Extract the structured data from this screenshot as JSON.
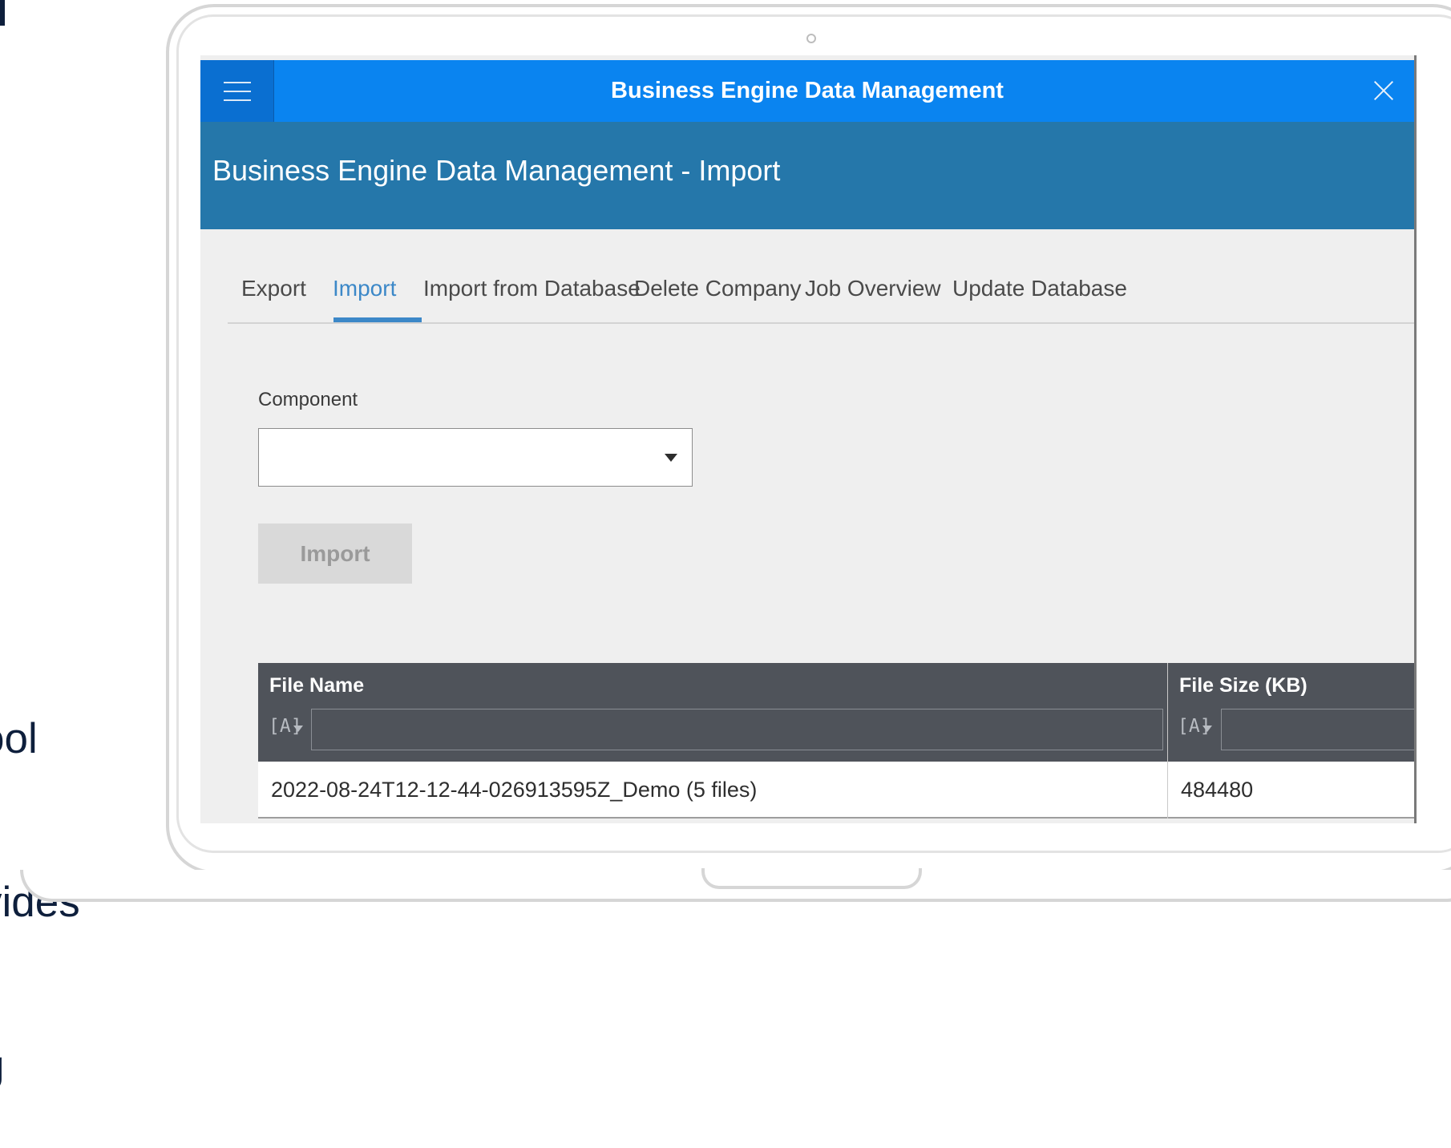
{
  "side_text": {
    "line1": "ool",
    "line2": "vides",
    "line3": "g"
  },
  "shellbar": {
    "title": "Business Engine Data Management"
  },
  "page": {
    "title": "Business Engine Data Management - Import"
  },
  "tabs": [
    {
      "label": "Export",
      "active": false
    },
    {
      "label": "Import",
      "active": true
    },
    {
      "label": "Import from Database",
      "active": false
    },
    {
      "label": "Delete Company",
      "active": false
    },
    {
      "label": "Job Overview",
      "active": false
    },
    {
      "label": "Update Database",
      "active": false
    }
  ],
  "form": {
    "component_label": "Component",
    "component_value": "",
    "import_button": "Import",
    "import_button_enabled": false
  },
  "table": {
    "columns": [
      "File Name",
      "File Size (KB)"
    ],
    "filter_icon_glyph": "[A]",
    "rows": [
      {
        "file_name": "2022-08-24T12-12-44-026913595Z_Demo (5 files)",
        "file_size": "484480"
      }
    ]
  },
  "colors": {
    "shellbar": "#0a84f0",
    "header": "#2577aa",
    "active_tab": "#3c88c8",
    "table_header": "#4f535a"
  }
}
